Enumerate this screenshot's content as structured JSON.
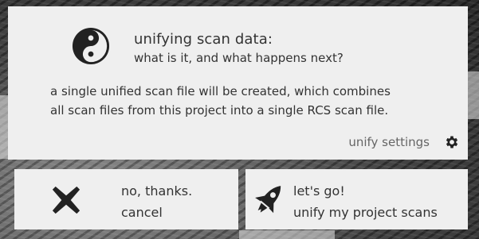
{
  "dialog": {
    "title": "unifying scan data:",
    "subtitle": "what is it, and what happens next?",
    "body_line1": "a single unified scan file will be created, which combines",
    "body_line2": "all scan files from this project into a single RCS scan file.",
    "settings_label": "unify settings",
    "logo_icon": "yin-yang-icon",
    "settings_icon": "gear-icon"
  },
  "actions": {
    "cancel": {
      "line1": "no, thanks.",
      "line2": "cancel",
      "icon": "close-x-icon"
    },
    "confirm": {
      "line1": "let's go!",
      "line2": "unify my project scans",
      "icon": "rocket-icon"
    }
  },
  "colors": {
    "panel": "#efefef",
    "text": "#333333",
    "muted_text": "#666666",
    "icon": "#222222"
  }
}
